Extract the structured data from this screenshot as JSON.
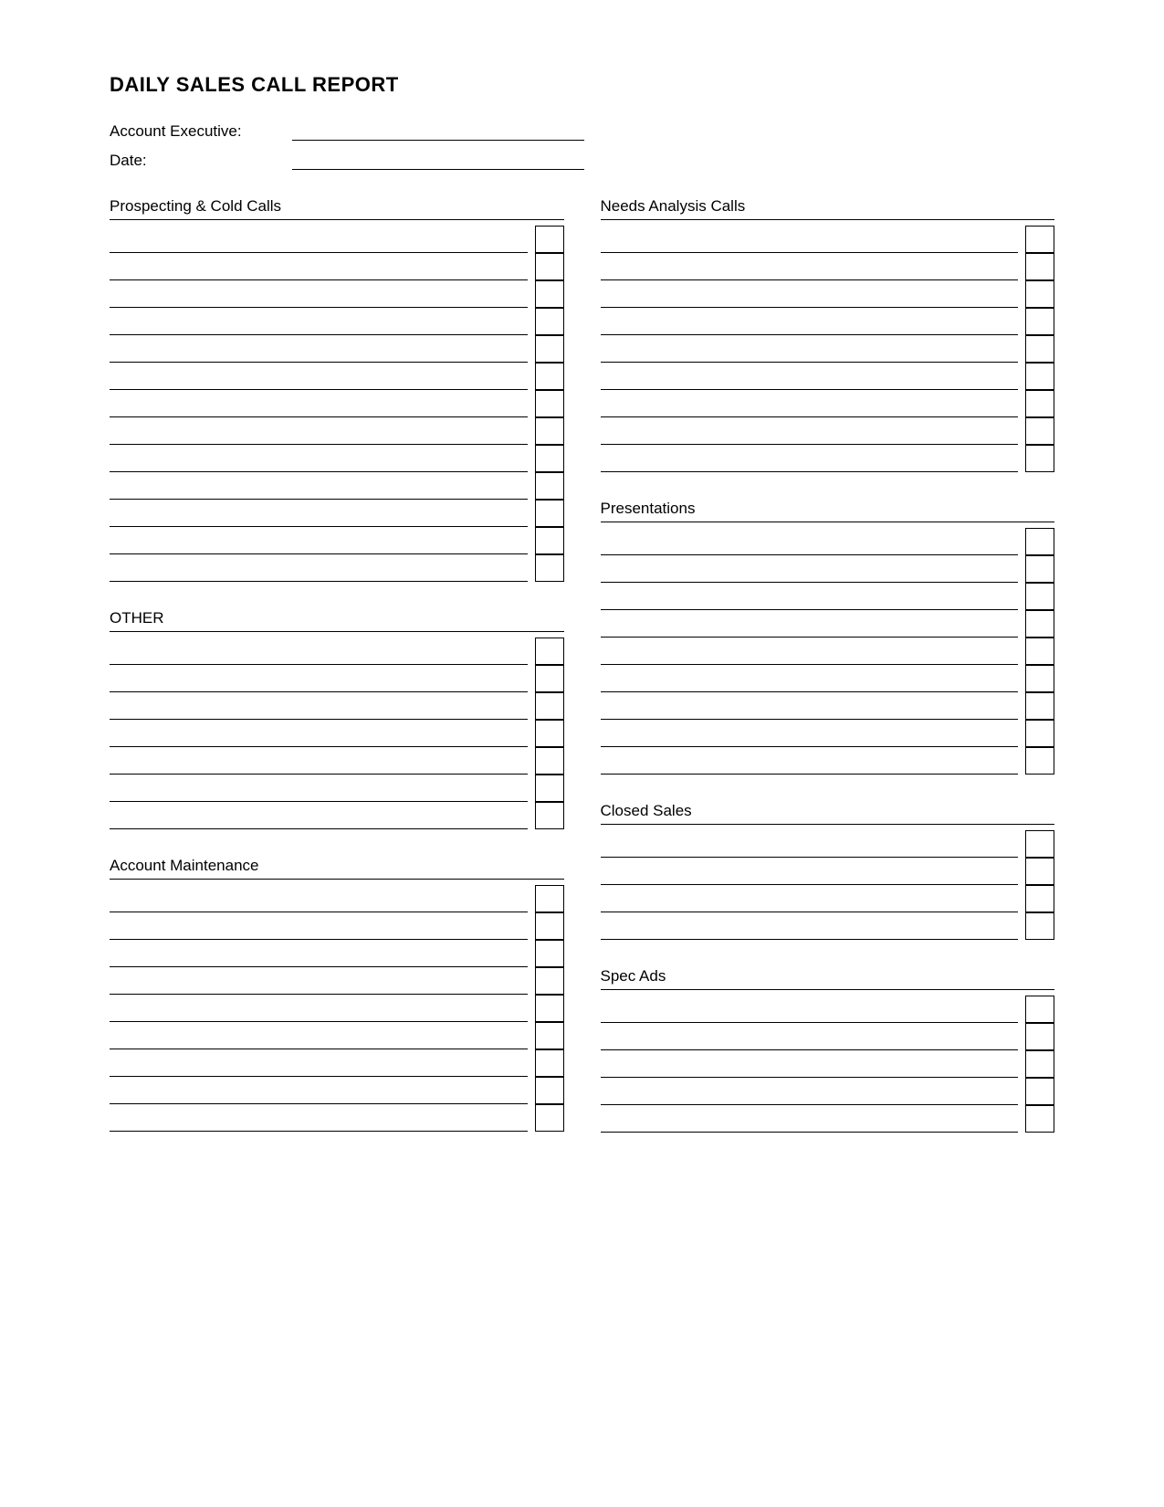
{
  "report": {
    "title": "DAILY SALES CALL REPORT",
    "fields": {
      "account_executive_label": "Account Executive:",
      "date_label": "Date:"
    },
    "sections": {
      "prospecting": {
        "title": "Prospecting & Cold Calls",
        "rows": 13
      },
      "other": {
        "title": "OTHER",
        "rows": 7
      },
      "needs_analysis": {
        "title": "Needs Analysis Calls",
        "rows": 9
      },
      "presentations": {
        "title": "Presentations",
        "rows": 9
      },
      "account_maintenance": {
        "title": "Account Maintenance",
        "rows": 9
      },
      "closed_sales": {
        "title": "Closed Sales",
        "rows": 4
      },
      "spec_ads": {
        "title": "Spec Ads",
        "rows": 5
      }
    }
  }
}
